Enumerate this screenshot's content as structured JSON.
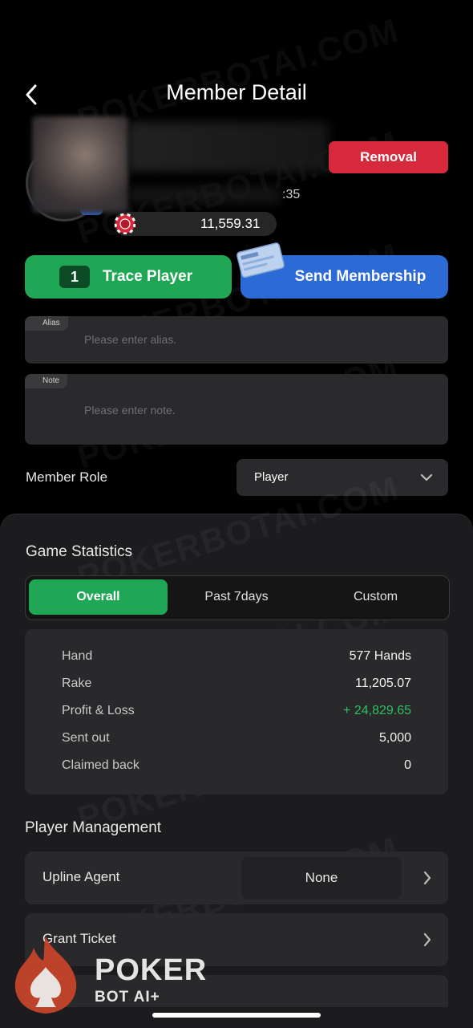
{
  "header": {
    "title": "Member Detail"
  },
  "profile": {
    "id_suffix": ":35",
    "balance": "11,559.31",
    "removal_label": "Removal"
  },
  "actions": {
    "trace_count": "1",
    "trace_label": "Trace Player",
    "send_label": "Send Membership"
  },
  "fields": {
    "alias": {
      "tag": "Alias",
      "placeholder": "Please enter alias."
    },
    "note": {
      "tag": "Note",
      "placeholder": "Please enter note."
    }
  },
  "member_role": {
    "label": "Member Role",
    "value": "Player"
  },
  "game_statistics": {
    "title": "Game Statistics",
    "tabs": [
      {
        "label": "Overall",
        "active": true
      },
      {
        "label": "Past 7days",
        "active": false
      },
      {
        "label": "Custom",
        "active": false
      }
    ],
    "rows": [
      {
        "label": "Hand",
        "value": "577 Hands"
      },
      {
        "label": "Rake",
        "value": "11,205.07"
      },
      {
        "label": "Profit & Loss",
        "value": "+ 24,829.65"
      },
      {
        "label": "Sent out",
        "value": "5,000"
      },
      {
        "label": "Claimed back",
        "value": "0"
      }
    ]
  },
  "player_management": {
    "title": "Player Management",
    "items": [
      {
        "label": "Upline Agent",
        "value": "None"
      },
      {
        "label": "Grant Ticket"
      }
    ]
  },
  "watermark": "POKERBOTAI.COM",
  "logo": {
    "line1": "POKER",
    "line2": "BOT AI+"
  },
  "colors": {
    "green": "#1fa756",
    "blue": "#2c6ad6",
    "red": "#d6293b",
    "profit": "#2fbf63"
  }
}
